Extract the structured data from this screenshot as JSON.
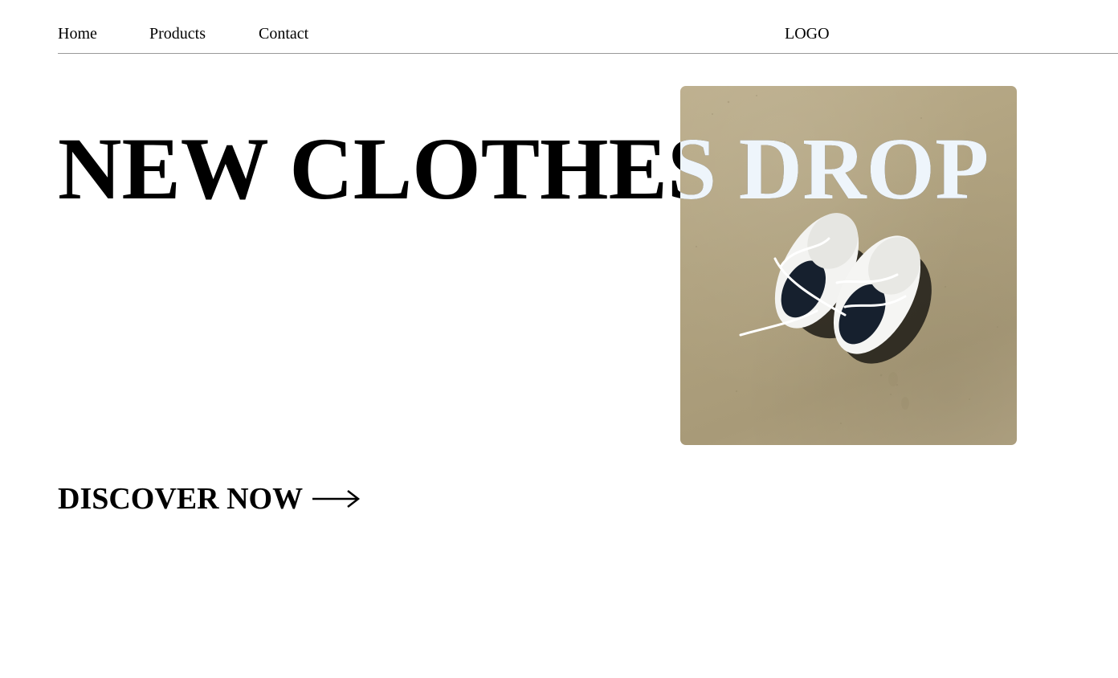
{
  "nav": {
    "items": [
      {
        "label": "Home"
      },
      {
        "label": "Products"
      },
      {
        "label": "Contact"
      }
    ]
  },
  "brand": {
    "logo_text": "LOGO"
  },
  "hero": {
    "headline": "NEW CLOTHES DROP",
    "image_icon": "sneakers-on-sand-photo",
    "cta_label": "DISCOVER NOW",
    "cta_icon": "arrow-right-icon"
  },
  "colors": {
    "text": "#000000",
    "headline_over_image": "#eef5fb",
    "divider": "#9a9a9a",
    "sand": "#b0a27f"
  }
}
